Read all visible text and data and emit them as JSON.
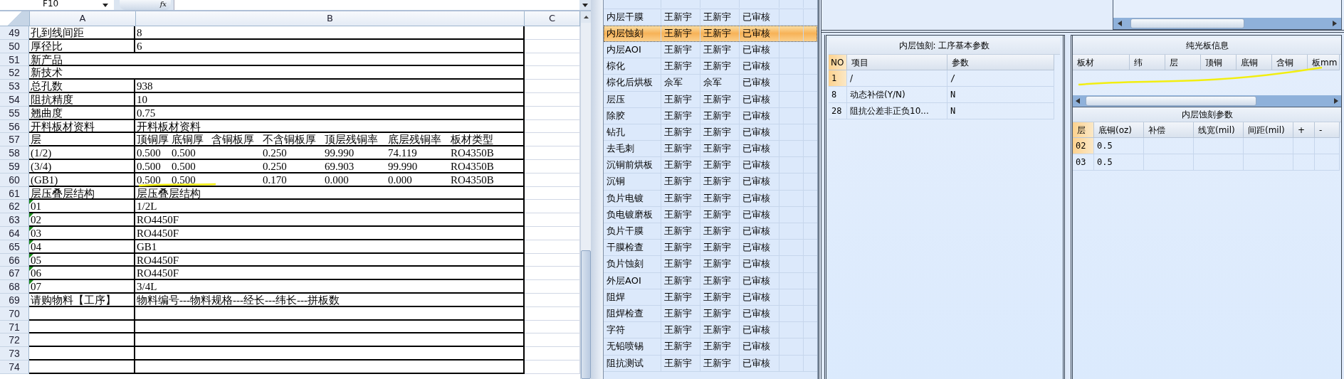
{
  "spreadsheet": {
    "name_box": "F10",
    "formula_button": "fx",
    "columns": [
      "A",
      "B",
      "C"
    ],
    "rows": [
      {
        "num": "49",
        "kind": "pair",
        "a": "孔到线间距",
        "b": "8",
        "flagged": false
      },
      {
        "num": "50",
        "kind": "pair",
        "a": "厚径比",
        "b": "6",
        "flagged": false
      },
      {
        "num": "51",
        "kind": "merged",
        "a": "新产品",
        "flagged": false
      },
      {
        "num": "52",
        "kind": "merged",
        "a": "新技术",
        "flagged": false
      },
      {
        "num": "53",
        "kind": "pair",
        "a": "总孔数",
        "b": "938",
        "flagged": false
      },
      {
        "num": "54",
        "kind": "pair",
        "a": "阻抗精度",
        "b": "10",
        "flagged": false
      },
      {
        "num": "55",
        "kind": "pair",
        "a": "翘曲度",
        "b": "0.75",
        "flagged": false
      },
      {
        "num": "56",
        "kind": "pair",
        "a": "开料板材资料",
        "b": "开料板材资料",
        "flagged": false
      },
      {
        "num": "57",
        "kind": "columns",
        "a": "层",
        "values": [
          {
            "text": "顶铜厚"
          },
          {
            "text": "底铜厚"
          },
          {
            "text": "含铜板厚"
          },
          {
            "text": "不含铜板厚"
          },
          {
            "text": "顶层残铜率"
          },
          {
            "text": "底层残铜率"
          },
          {
            "text": "板材类型"
          }
        ],
        "flagged": false
      },
      {
        "num": "58",
        "kind": "columns",
        "a": "(1/2)",
        "values": [
          {
            "text": "0.500"
          },
          {
            "text": "0.500"
          },
          {
            "blank": true
          },
          {
            "text": "0.250"
          },
          {
            "text": "99.990"
          },
          {
            "text": "74.119"
          },
          {
            "text": "RO4350B"
          }
        ],
        "flagged": false
      },
      {
        "num": "59",
        "kind": "columns",
        "a": "(3/4)",
        "values": [
          {
            "text": "0.500"
          },
          {
            "text": "0.500"
          },
          {
            "blank": true
          },
          {
            "text": "0.250"
          },
          {
            "text": "69.903"
          },
          {
            "text": "99.990"
          },
          {
            "text": "RO4350B"
          }
        ],
        "flagged": false
      },
      {
        "num": "60",
        "kind": "columns",
        "a": "(GB1)",
        "values": [
          {
            "text": "0.500"
          },
          {
            "text": "0.500"
          },
          {
            "blank": true
          },
          {
            "text": "0.170"
          },
          {
            "text": "0.000"
          },
          {
            "text": "0.000"
          },
          {
            "text": "RO4350B"
          }
        ],
        "flagged": false
      },
      {
        "num": "61",
        "kind": "pair",
        "a": "层压叠层结构",
        "b": "层压叠层结构",
        "flagged": false
      },
      {
        "num": "62",
        "kind": "pair",
        "a": "01",
        "b": "1/2L",
        "flagged": true
      },
      {
        "num": "63",
        "kind": "pair",
        "a": "02",
        "b": "RO4450F",
        "flagged": true
      },
      {
        "num": "64",
        "kind": "pair",
        "a": "03",
        "b": "RO4450F",
        "flagged": true
      },
      {
        "num": "65",
        "kind": "pair",
        "a": "04",
        "b": "GB1",
        "flagged": true
      },
      {
        "num": "66",
        "kind": "pair",
        "a": "05",
        "b": "RO4450F",
        "flagged": true
      },
      {
        "num": "67",
        "kind": "pair",
        "a": "06",
        "b": "RO4450F",
        "flagged": true
      },
      {
        "num": "68",
        "kind": "pair",
        "a": "07",
        "b": "3/4L",
        "flagged": true
      },
      {
        "num": "69",
        "kind": "pair",
        "a": "请购物料【工序】",
        "b": "物料编号---物料规格---经长---纬长---拼板数",
        "flagged": false
      },
      {
        "num": "70",
        "kind": "empty"
      },
      {
        "num": "71",
        "kind": "empty"
      },
      {
        "num": "72",
        "kind": "empty"
      },
      {
        "num": "73",
        "kind": "empty"
      },
      {
        "num": "74",
        "kind": "empty"
      }
    ]
  },
  "process_list": {
    "rows": [
      {
        "step": "内层干膜",
        "operator": "王新宇",
        "reviewer": "王新宇",
        "status": "已审核",
        "selected": false
      },
      {
        "step": "内层蚀刻",
        "operator": "王新宇",
        "reviewer": "王新宇",
        "status": "已审核",
        "selected": true
      },
      {
        "step": "内层AOI",
        "operator": "王新宇",
        "reviewer": "王新宇",
        "status": "已审核",
        "selected": false
      },
      {
        "step": "棕化",
        "operator": "王新宇",
        "reviewer": "王新宇",
        "status": "已审核",
        "selected": false
      },
      {
        "step": "棕化后烘板",
        "operator": "佘军",
        "reviewer": "佘军",
        "status": "已审核",
        "selected": false
      },
      {
        "step": "层压",
        "operator": "王新宇",
        "reviewer": "王新宇",
        "status": "已审核",
        "selected": false
      },
      {
        "step": "除胶",
        "operator": "王新宇",
        "reviewer": "王新宇",
        "status": "已审核",
        "selected": false
      },
      {
        "step": "钻孔",
        "operator": "王新宇",
        "reviewer": "王新宇",
        "status": "已审核",
        "selected": false
      },
      {
        "step": "去毛刺",
        "operator": "王新宇",
        "reviewer": "王新宇",
        "status": "已审核",
        "selected": false
      },
      {
        "step": "沉铜前烘板",
        "operator": "王新宇",
        "reviewer": "王新宇",
        "status": "已审核",
        "selected": false
      },
      {
        "step": "沉铜",
        "operator": "王新宇",
        "reviewer": "王新宇",
        "status": "已审核",
        "selected": false
      },
      {
        "step": "负片电镀",
        "operator": "王新宇",
        "reviewer": "王新宇",
        "status": "已审核",
        "selected": false
      },
      {
        "step": "负电镀磨板",
        "operator": "王新宇",
        "reviewer": "王新宇",
        "status": "已审核",
        "selected": false
      },
      {
        "step": "负片干膜",
        "operator": "王新宇",
        "reviewer": "王新宇",
        "status": "已审核",
        "selected": false
      },
      {
        "step": "干膜检查",
        "operator": "王新宇",
        "reviewer": "王新宇",
        "status": "已审核",
        "selected": false
      },
      {
        "step": "负片蚀刻",
        "operator": "王新宇",
        "reviewer": "王新宇",
        "status": "已审核",
        "selected": false
      },
      {
        "step": "外层AOI",
        "operator": "王新宇",
        "reviewer": "王新宇",
        "status": "已审核",
        "selected": false
      },
      {
        "step": "阻焊",
        "operator": "王新宇",
        "reviewer": "王新宇",
        "status": "已审核",
        "selected": false
      },
      {
        "step": "阻焊检查",
        "operator": "王新宇",
        "reviewer": "王新宇",
        "status": "已审核",
        "selected": false
      },
      {
        "step": "字符",
        "operator": "王新宇",
        "reviewer": "王新宇",
        "status": "已审核",
        "selected": false
      },
      {
        "step": "无铅喷锡",
        "operator": "王新宇",
        "reviewer": "王新宇",
        "status": "已审核",
        "selected": false
      },
      {
        "step": "阻抗测试",
        "operator": "王新宇",
        "reviewer": "王新宇",
        "status": "已审核",
        "selected": false
      }
    ]
  },
  "basic_params": {
    "title": "内层蚀刻: 工序基本参数",
    "columns": [
      "NO",
      "项目",
      "参数"
    ],
    "rows": [
      {
        "no": "1",
        "item": "/",
        "value": "/",
        "selected": true
      },
      {
        "no": "8",
        "item": "动态补偿(Y/N)",
        "value": "N",
        "selected": false
      },
      {
        "no": "28",
        "item": "阻抗公差非正负10...",
        "value": "N",
        "selected": false
      }
    ]
  },
  "board_info": {
    "title": "纯光板信息",
    "columns": [
      "板材",
      "纬",
      "层",
      "顶铜",
      "底铜",
      "含铜",
      "板mm"
    ]
  },
  "etch_params": {
    "title": "内层蚀刻参数",
    "columns": [
      "层",
      "底铜(oz)",
      "补偿",
      "线宽(mil)",
      "间距(mil)",
      "+",
      "-"
    ],
    "rows": [
      {
        "layer": "02",
        "base_copper": "0.5",
        "selected": true
      },
      {
        "layer": "03",
        "base_copper": "0.5",
        "selected": false
      }
    ]
  }
}
